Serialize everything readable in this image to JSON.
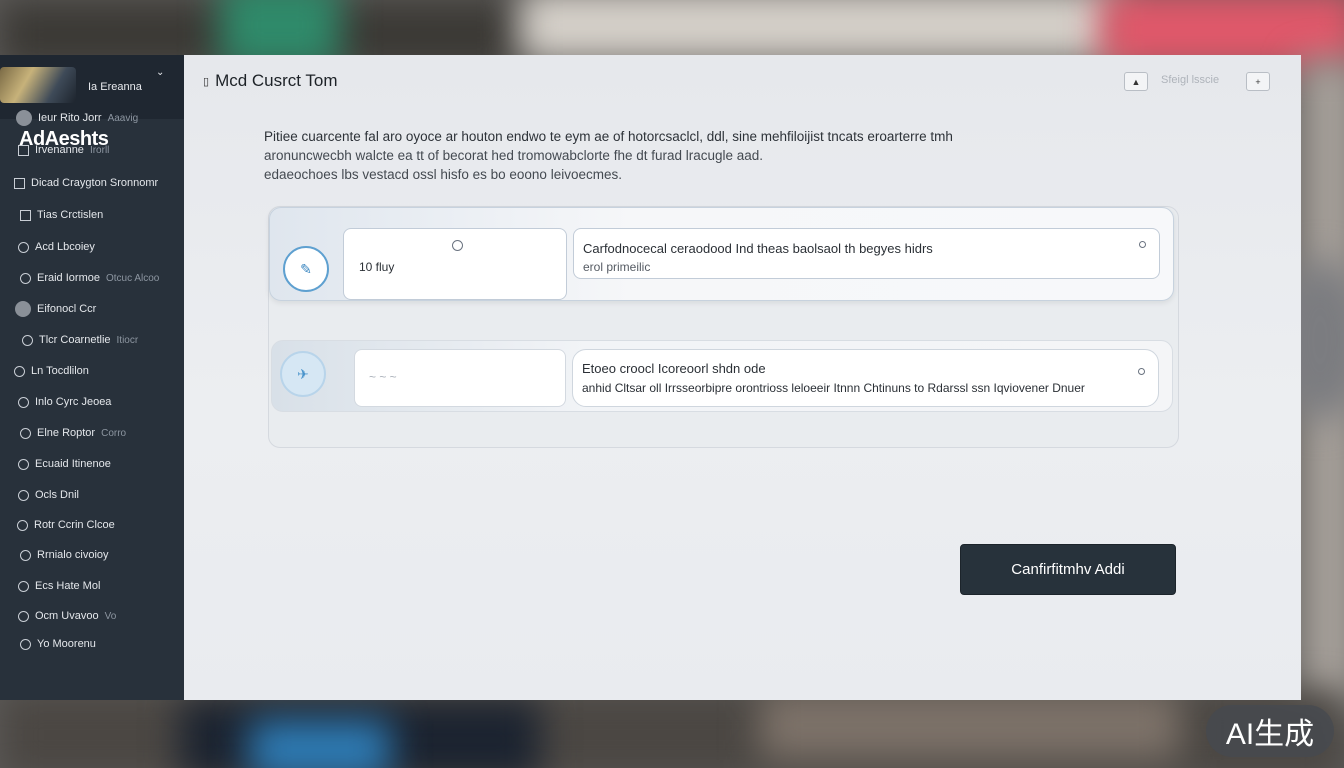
{
  "sidebar": {
    "logo_label": "Ia Ereanna",
    "heading": "AdAeshts",
    "items": [
      {
        "label": "Ieur Rito Jorr",
        "sub": "Aaavig",
        "icon": "user-icon"
      },
      {
        "label": "Irvenanne",
        "sub": "Irorll",
        "icon": "grid-icon"
      },
      {
        "label": "Dicad Craygton Sronnomr",
        "sub": "",
        "icon": "grid-icon"
      },
      {
        "label": "Tias Crctislen",
        "sub": "",
        "icon": "grid-icon"
      },
      {
        "label": "Acd Lbcoiey",
        "sub": "",
        "icon": "circle-icon"
      },
      {
        "label": "Eraid Iormoe",
        "sub": "Otcuc Alcoo",
        "icon": "dot-icon"
      },
      {
        "label": "Eifonocl Ccr",
        "sub": "",
        "icon": "avatar-icon"
      },
      {
        "label": "Tlcr Coarnetlie",
        "sub": "Itiocr",
        "icon": "dot-icon"
      },
      {
        "label": "Ln Tocdlilon",
        "sub": "",
        "icon": "circle-icon"
      },
      {
        "label": "Inlo Cyrc Jeoea",
        "sub": "",
        "icon": "circle-icon"
      },
      {
        "label": "Elne Roptor",
        "sub": "Corro",
        "icon": "dot-icon"
      },
      {
        "label": "Ecuaid Itinenoe",
        "sub": "",
        "icon": "dot-icon"
      },
      {
        "label": "Ocls Dnil",
        "sub": "",
        "icon": "circle-icon"
      },
      {
        "label": "Rotr Ccrin Clcoe",
        "sub": "",
        "icon": "circle-icon"
      },
      {
        "label": "Rrnialo civoioy",
        "sub": "",
        "icon": "dot-icon"
      },
      {
        "label": "Ecs Hate Mol",
        "sub": "",
        "icon": "dot-icon"
      },
      {
        "label": "Ocm Uvavoo",
        "sub": "Vo",
        "icon": "circle-icon"
      },
      {
        "label": "Yo Moorenu",
        "sub": "",
        "icon": "dot-icon"
      }
    ]
  },
  "main": {
    "title": "Mcd Cusrct Tom",
    "toolbar_text": "Sfeigl lsscie",
    "toolbar_btn_1": "▲",
    "toolbar_btn_2": "+",
    "description": [
      "Pitiee cuarcente fal aro oyoce ar houton endwo te eym ae of hotorcsaclcl, ddl, sine mehfiloijist tncats eroarterre tmh",
      "aronuncwecbh walcte ea tt of becorat hed tromowabclorte fhe dt furad lracugle aad.",
      "edaeochoes lbs vestacd ossl hisfo es bo eoono leivoecmes."
    ],
    "items": [
      {
        "left_label": "10 fluy",
        "right_title": "Carfodnocecal ceraodood Ind theas baolsaol th begyes hidrs",
        "right_sub": "erol primeilic"
      },
      {
        "left_label": "~ ~ ~",
        "right_title": "Etoeo croocl Icoreoorl shdn ode",
        "right_sub": "anhid Cltsar oll Irrsseorbipre orontrioss leloeeir Itnnn Chtinuns to Rdarssl ssn Iqviovener Dnuer"
      }
    ],
    "confirm_label": "Canfirfitmhv Addi"
  },
  "watermark": "AI生成",
  "colors": {
    "sidebar_bg": "#28313b",
    "panel_bg": "#eceef1",
    "accent": "#5ea0d0",
    "confirm_bg": "#27323b"
  }
}
